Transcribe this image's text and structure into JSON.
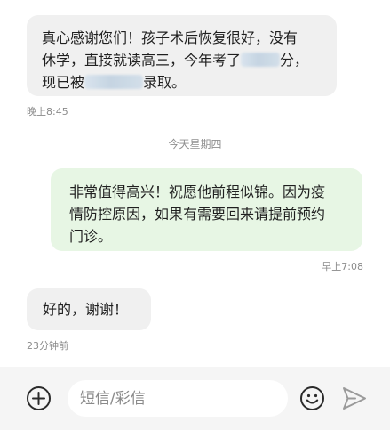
{
  "messages": [
    {
      "direction": "received",
      "line1": "真心感谢您们！孩子术后恢复很好，没有",
      "line2": "休学，直接就读高三，今年考了",
      "line2_end": "分，",
      "line3_start": "现已被",
      "line3_end": "录取。",
      "time": "晚上8:45"
    },
    {
      "direction": "sent",
      "line1": "非常值得高兴！祝愿他前程似锦。因为疫",
      "line2": "情防控原因，如果有需要回来请提前预约",
      "line3": "门诊。",
      "time": "早上7:08"
    },
    {
      "direction": "received",
      "text": "好的，谢谢！",
      "time": "23分钟前"
    }
  ],
  "date_separator": "今天星期四",
  "composer": {
    "placeholder": "短信/彩信",
    "add_icon": "plus-circle-icon",
    "emoji_icon": "smiley-icon",
    "send_icon": "send-arrow-icon"
  },
  "colors": {
    "received_bubble": "#f0f0f0",
    "sent_bubble": "#e7f6e4",
    "timestamp_text": "#8a8a8a",
    "input_bar_bg": "#f5f5f5"
  }
}
